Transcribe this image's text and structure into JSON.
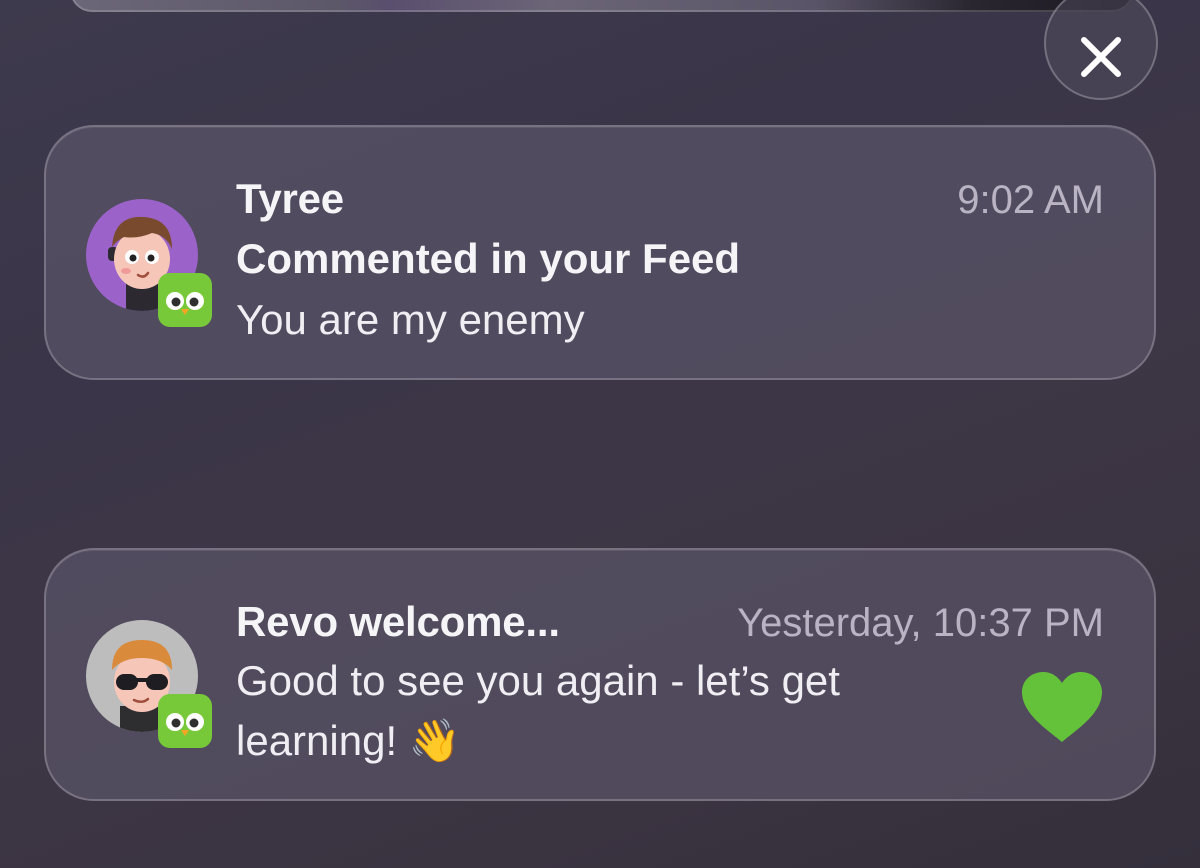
{
  "close_button": {
    "icon": "close-icon"
  },
  "notifications": [
    {
      "sender": "Tyree",
      "time": "9:02 AM",
      "subtitle": "Commented in your Feed",
      "message": "You are my enemy",
      "avatar": "avatar-tyree",
      "app_icon": "duolingo-owl-icon"
    },
    {
      "sender": "Revo welcome...",
      "time": "Yesterday, 10:37 PM",
      "message": "Good to see you again - let’s get learning!",
      "emoji": "👋",
      "avatar": "avatar-revo",
      "app_icon": "duolingo-owl-icon",
      "reaction_icon": "heart-icon",
      "accent_color": "#64c23a"
    }
  ]
}
